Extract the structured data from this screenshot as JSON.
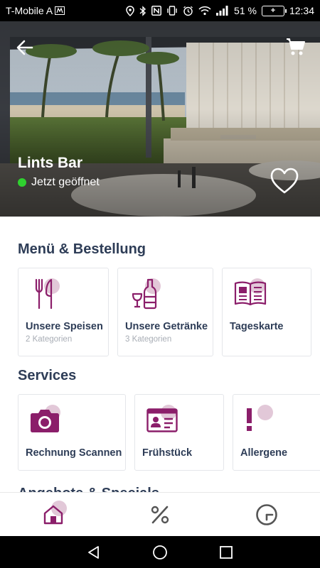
{
  "status_bar": {
    "carrier": "T-Mobile A",
    "battery": "51 %",
    "time": "12:34",
    "icons": [
      "sim-icon",
      "location-icon",
      "bluetooth-icon",
      "nfc-icon",
      "vibrate-icon",
      "alarm-icon",
      "wifi-icon",
      "signal-icon",
      "battery-icon"
    ]
  },
  "header": {
    "venue_name": "Lints Bar",
    "status": "Jetzt geöffnet",
    "status_color": "#2fd12f"
  },
  "menu_section": {
    "title": "Menü & Bestellung",
    "cards": [
      {
        "title": "Unsere Speisen",
        "subtitle": "2 Kategorien",
        "icon": "cutlery-icon"
      },
      {
        "title": "Unsere Getränke",
        "subtitle": "3 Kategorien",
        "icon": "drinks-icon"
      },
      {
        "title": "Tageskarte",
        "subtitle": "",
        "icon": "daily-menu-icon"
      }
    ]
  },
  "services_section": {
    "title": "Services",
    "cards": [
      {
        "title": "Rechnung Scannen",
        "icon": "camera-icon"
      },
      {
        "title": "Frühstück",
        "icon": "id-card-icon"
      },
      {
        "title": "Allergene",
        "icon": "exclamation-icon"
      }
    ]
  },
  "next_section": {
    "title": "Angebote & Specials"
  },
  "bottom_nav": [
    {
      "name": "home",
      "icon": "home-icon",
      "active": true
    },
    {
      "name": "offers",
      "icon": "percent-icon",
      "active": false
    },
    {
      "name": "history",
      "icon": "clock-icon",
      "active": false
    }
  ],
  "colors": {
    "accent": "#8b1e6a",
    "accent_light": "#e2c8d8",
    "heading": "#2e3d57",
    "muted": "#a8adb5"
  }
}
